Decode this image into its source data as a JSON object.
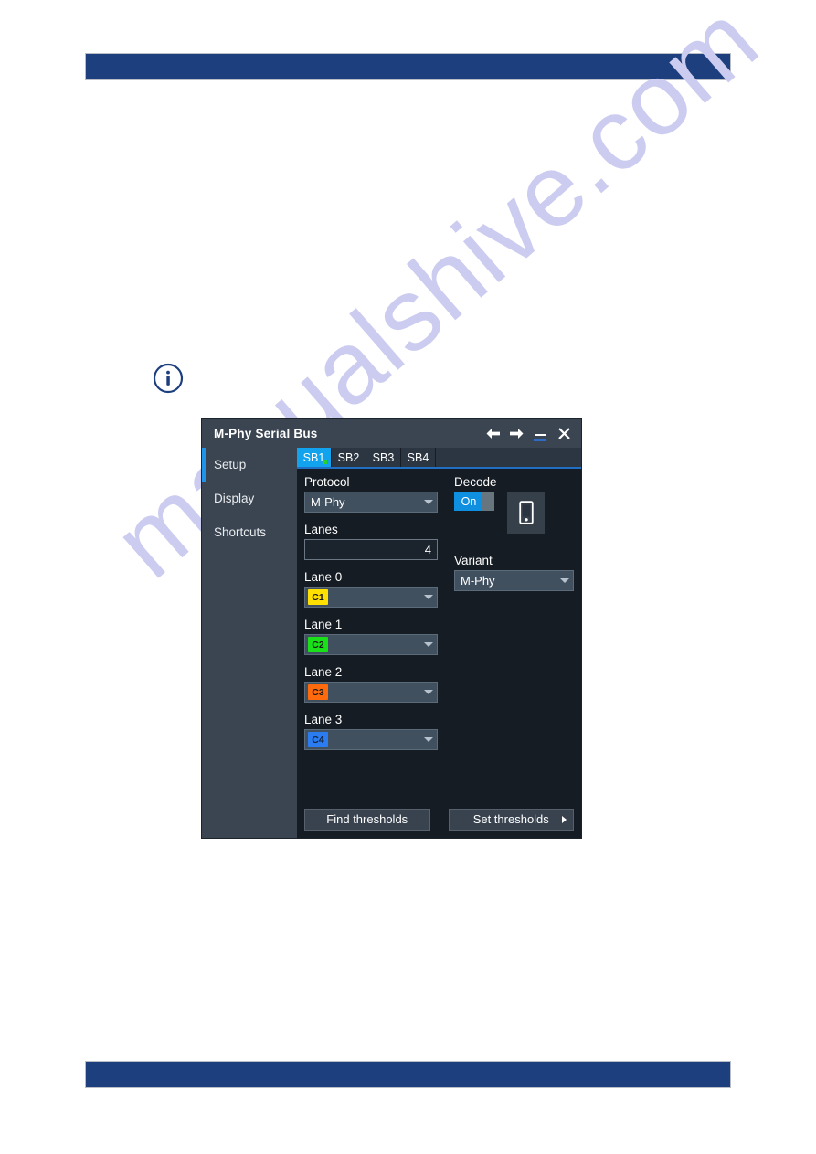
{
  "page": {
    "header_bar_color": "#1d3f7e",
    "footer_bar_color": "#1d3f7e",
    "watermark_text": "manualshive.com",
    "watermark_color": "#ccccf0",
    "info_icon": "info-circle-icon"
  },
  "dialog": {
    "title": "M-Phy Serial Bus",
    "titlebar": {
      "back_icon": "arrow-left-icon",
      "forward_icon": "arrow-right-icon",
      "minimize_icon": "minimize-icon",
      "close_icon": "close-icon"
    },
    "sidebar": {
      "items": [
        {
          "label": "Setup",
          "active": true
        },
        {
          "label": "Display",
          "active": false
        },
        {
          "label": "Shortcuts",
          "active": false
        }
      ]
    },
    "tabs": [
      {
        "label": "SB1",
        "active": true,
        "indicator": "green-dot"
      },
      {
        "label": "SB2",
        "active": false
      },
      {
        "label": "SB3",
        "active": false
      },
      {
        "label": "SB4",
        "active": false
      }
    ],
    "form": {
      "protocol": {
        "label": "Protocol",
        "value": "M-Phy",
        "caret_icon": "chevron-down-icon"
      },
      "decode": {
        "label": "Decode",
        "value": "On",
        "state": "on",
        "accent": "#0e8fe0"
      },
      "device_button": {
        "icon": "mobile-device-icon"
      },
      "lanes": {
        "label": "Lanes",
        "value": "4"
      },
      "variant": {
        "label": "Variant",
        "value": "M-Phy",
        "caret_icon": "chevron-down-icon"
      },
      "lane_rows": [
        {
          "label": "Lane 0",
          "channel": "C1",
          "color": "#ffe000"
        },
        {
          "label": "Lane 1",
          "channel": "C2",
          "color": "#1ae01a"
        },
        {
          "label": "Lane 2",
          "channel": "C3",
          "color": "#ff6a0d"
        },
        {
          "label": "Lane 3",
          "channel": "C4",
          "color": "#2a7cf0"
        }
      ]
    },
    "buttons": {
      "find_thresholds": "Find thresholds",
      "set_thresholds": "Set thresholds",
      "set_thresholds_caret": "submenu-arrow-icon"
    }
  }
}
